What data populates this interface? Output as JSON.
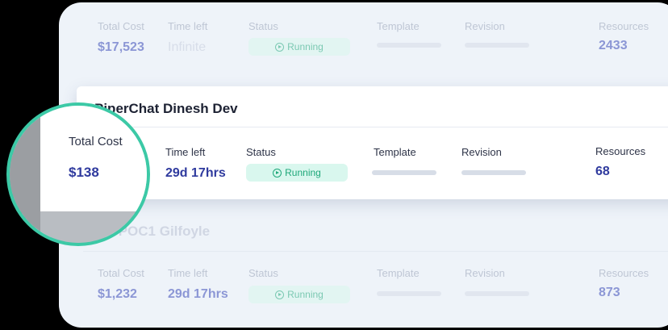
{
  "field_labels": {
    "total_cost": "Total Cost",
    "time_left": "Time left",
    "status": "Status",
    "template": "Template",
    "revision": "Revision",
    "resources": "Resources"
  },
  "rows": [
    {
      "total_cost": "$17,523",
      "time_left": "Infinite",
      "status": "Running",
      "resources": "2433"
    },
    {
      "title": "PiperChat Dinesh Dev",
      "total_cost": "$138",
      "time_left": "29d 17hrs",
      "status": "Running",
      "resources": "68"
    },
    {
      "title": "AI POC1 Gilfoyle",
      "total_cost": "$1,232",
      "time_left": "29d 17hrs",
      "status": "Running",
      "resources": "873"
    }
  ],
  "colors": {
    "accent": "#2f3a9e",
    "running_bg": "#d9f7ee",
    "running_text": "#1ea779",
    "highlight_ring": "#3cc9a6"
  },
  "icons": {
    "status": "play-circle-icon"
  }
}
